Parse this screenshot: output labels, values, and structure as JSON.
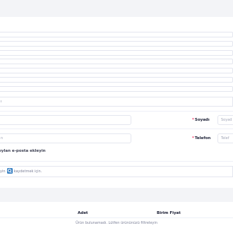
{
  "form": {
    "partial_field_text": "ı",
    "soyadi_label": "Soyadı",
    "soyadi_placeholder": "Soyad",
    "telefon_label": "Telefon",
    "telefon_placeholder": "Telef",
    "left_field_text": "n",
    "required_mark": "*",
    "email_section_title": "ıylan e-posta ekleyin",
    "info_text_before": "yin",
    "info_text_after": "kaydetmek için."
  },
  "table": {
    "col_adet": "Adet",
    "col_birim_fiyat": "Birim Fiyat",
    "empty_message": "Ürün bulunamadı. Lütfen ürününüzü filtreleyin"
  }
}
